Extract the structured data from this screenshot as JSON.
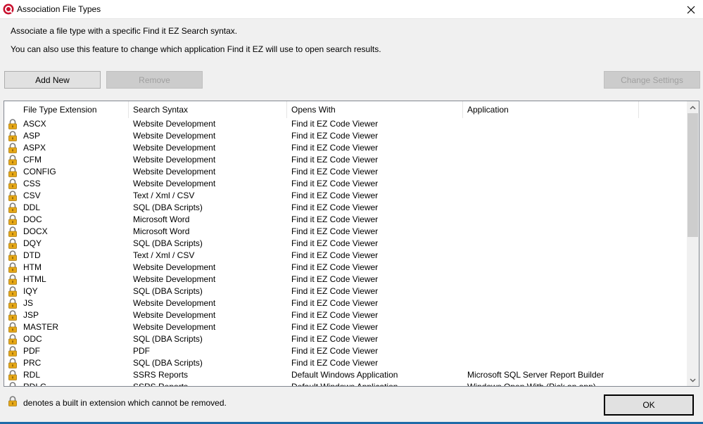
{
  "window": {
    "title": "Association File Types",
    "app_icon": "find-it-ez-icon",
    "close_icon": "close-icon"
  },
  "description": {
    "line1": "Associate a file type with a specific Find it EZ Search syntax.",
    "line2": "You can also use this feature to change which application Find it EZ will use to open search results."
  },
  "toolbar": {
    "add_new": "Add New",
    "remove": "Remove",
    "change_settings": "Change Settings"
  },
  "table": {
    "columns": [
      "File Type Extension",
      "Search Syntax",
      "Opens With",
      "Application"
    ],
    "rows": [
      {
        "ext": "ASCX",
        "syntax": "Website Development",
        "opens": "Find it EZ Code Viewer",
        "app": ""
      },
      {
        "ext": "ASP",
        "syntax": "Website Development",
        "opens": "Find it EZ Code Viewer",
        "app": ""
      },
      {
        "ext": "ASPX",
        "syntax": "Website Development",
        "opens": "Find it EZ Code Viewer",
        "app": ""
      },
      {
        "ext": "CFM",
        "syntax": "Website Development",
        "opens": "Find it EZ Code Viewer",
        "app": ""
      },
      {
        "ext": "CONFIG",
        "syntax": "Website Development",
        "opens": "Find it EZ Code Viewer",
        "app": ""
      },
      {
        "ext": "CSS",
        "syntax": "Website Development",
        "opens": "Find it EZ Code Viewer",
        "app": ""
      },
      {
        "ext": "CSV",
        "syntax": "Text / Xml / CSV",
        "opens": "Find it EZ Code Viewer",
        "app": ""
      },
      {
        "ext": "DDL",
        "syntax": "SQL (DBA Scripts)",
        "opens": "Find it EZ Code Viewer",
        "app": ""
      },
      {
        "ext": "DOC",
        "syntax": "Microsoft Word",
        "opens": "Find it EZ Code Viewer",
        "app": ""
      },
      {
        "ext": "DOCX",
        "syntax": "Microsoft Word",
        "opens": "Find it EZ Code Viewer",
        "app": ""
      },
      {
        "ext": "DQY",
        "syntax": "SQL (DBA Scripts)",
        "opens": "Find it EZ Code Viewer",
        "app": ""
      },
      {
        "ext": "DTD",
        "syntax": "Text / Xml / CSV",
        "opens": "Find it EZ Code Viewer",
        "app": ""
      },
      {
        "ext": "HTM",
        "syntax": "Website Development",
        "opens": "Find it EZ Code Viewer",
        "app": ""
      },
      {
        "ext": "HTML",
        "syntax": "Website Development",
        "opens": "Find it EZ Code Viewer",
        "app": ""
      },
      {
        "ext": "IQY",
        "syntax": "SQL (DBA Scripts)",
        "opens": "Find it EZ Code Viewer",
        "app": ""
      },
      {
        "ext": "JS",
        "syntax": "Website Development",
        "opens": "Find it EZ Code Viewer",
        "app": ""
      },
      {
        "ext": "JSP",
        "syntax": "Website Development",
        "opens": "Find it EZ Code Viewer",
        "app": ""
      },
      {
        "ext": "MASTER",
        "syntax": "Website Development",
        "opens": "Find it EZ Code Viewer",
        "app": ""
      },
      {
        "ext": "ODC",
        "syntax": "SQL (DBA Scripts)",
        "opens": "Find it EZ Code Viewer",
        "app": ""
      },
      {
        "ext": "PDF",
        "syntax": "PDF",
        "opens": "Find it EZ Code Viewer",
        "app": ""
      },
      {
        "ext": "PRC",
        "syntax": "SQL (DBA Scripts)",
        "opens": "Find it EZ Code Viewer",
        "app": ""
      },
      {
        "ext": "RDL",
        "syntax": "SSRS Reports",
        "opens": "Default Windows Application",
        "app": "Microsoft SQL Server Report Builder"
      },
      {
        "ext": "RDLC",
        "syntax": "SSRS Reports",
        "opens": "Default Windows Application",
        "app": "Windows Open With (Pick an app)"
      }
    ]
  },
  "footer": {
    "note": "denotes a built in extension which cannot be removed.",
    "ok": "OK"
  },
  "colors": {
    "window_bg": "#f0f0f0",
    "lock_body": "#e6a817",
    "accent_line": "#1e6aa8"
  }
}
